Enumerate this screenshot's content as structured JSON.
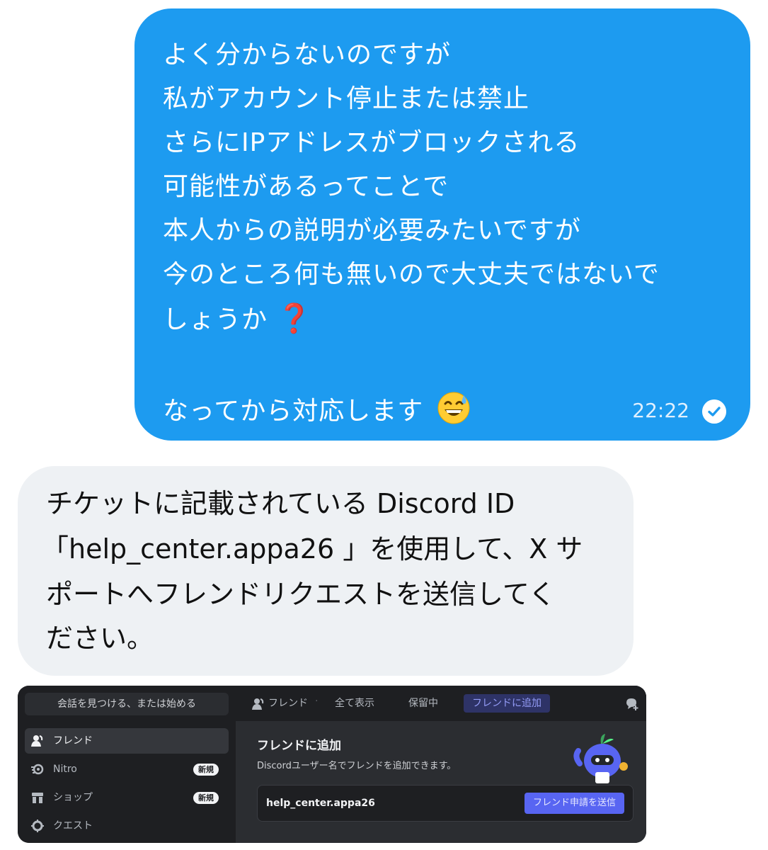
{
  "outgoing_message": {
    "lines": [
      "よく分からないのですが",
      "私がアカウント停止または禁止",
      "さらにIPアドレスがブロックされる",
      "可能性があるってことで",
      "本人からの説明が必要みたいですが",
      "今のところ何も無いので大丈夫ではないで",
      "しょうか",
      "なってから対応します"
    ],
    "question_emoji": "❓",
    "face_emoji": "grinning-sweat-emoji",
    "time": "22:22",
    "read_icon": "check-circle-icon"
  },
  "incoming_message": {
    "lines": [
      "チケットに記載されている Discord ID",
      "「help_center.appa26 」を使用して、X サ",
      "ポートへフレンドリクエストを送信してく",
      "ださい。"
    ]
  },
  "discord": {
    "search_placeholder": "会話を見つける、または始める",
    "sidebar": [
      {
        "label": "フレンド",
        "icon": "friends-icon",
        "badge": ""
      },
      {
        "label": "Nitro",
        "icon": "nitro-icon",
        "badge": "新規"
      },
      {
        "label": "ショップ",
        "icon": "shop-icon",
        "badge": "新規"
      },
      {
        "label": "クエスト",
        "icon": "quest-icon",
        "badge": ""
      }
    ],
    "tabs": {
      "friends": "フレンド",
      "all": "全て表示",
      "pending": "保留中",
      "add": "フレンドに追加"
    },
    "panel": {
      "title": "フレンドに追加",
      "subtitle": "Discordユーザー名でフレンドを追加できます。",
      "input_value": "help_center.appa26",
      "send_button": "フレンド申請を送信"
    },
    "colors": {
      "background": "#1e1f22",
      "accent": "#5865f2"
    }
  }
}
